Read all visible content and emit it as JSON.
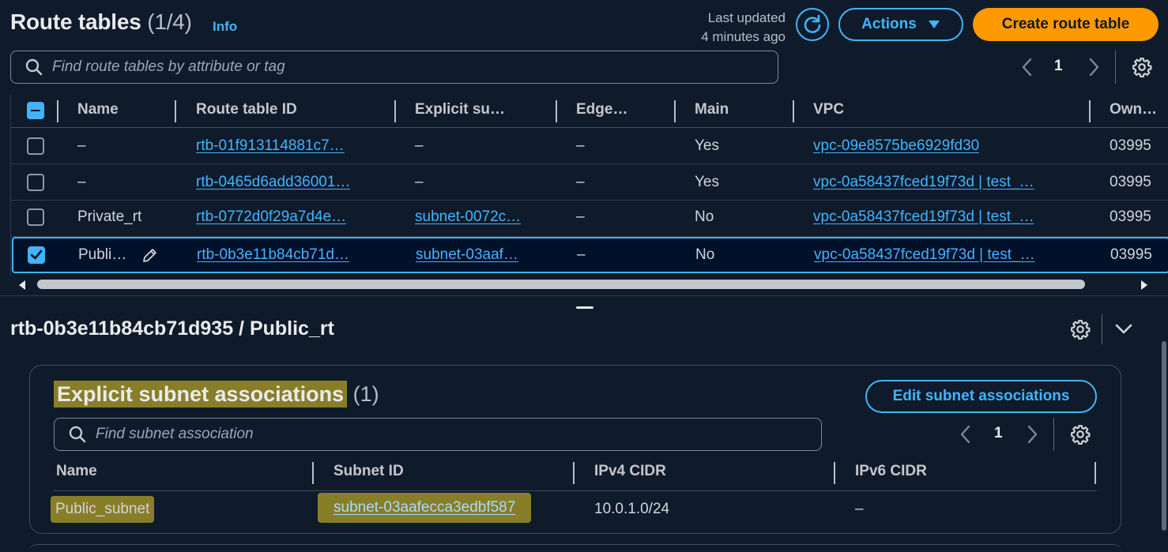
{
  "header": {
    "title": "Route tables",
    "count": "(1/4)",
    "info_label": "Info",
    "last_updated_line1": "Last updated",
    "last_updated_line2": "4 minutes ago",
    "actions_label": "Actions",
    "create_label": "Create route table"
  },
  "search": {
    "placeholder": "Find route tables by attribute or tag"
  },
  "pagination": {
    "page": "1"
  },
  "table": {
    "columns": [
      "Name",
      "Route table ID",
      "Explicit su…",
      "Edge…",
      "Main",
      "VPC",
      "Own…"
    ],
    "rows": [
      {
        "selected": false,
        "name": "–",
        "route_table_id": "rtb-01f913114881c7…",
        "explicit_subnet": "–",
        "edge": "–",
        "main": "Yes",
        "vpc": "vpc-09e8575be6929fd30",
        "owner": "03995"
      },
      {
        "selected": false,
        "name": "–",
        "route_table_id": "rtb-0465d6add36001…",
        "explicit_subnet": "–",
        "edge": "–",
        "main": "Yes",
        "vpc": "vpc-0a58437fced19f73d | test_…",
        "owner": "03995"
      },
      {
        "selected": false,
        "name": "Private_rt",
        "route_table_id": "rtb-0772d0f29a7d4e…",
        "explicit_subnet": "subnet-0072c…",
        "edge": "–",
        "main": "No",
        "vpc": "vpc-0a58437fced19f73d | test_…",
        "owner": "03995"
      },
      {
        "selected": true,
        "name": "Publi…",
        "route_table_id": "rtb-0b3e11b84cb71d…",
        "explicit_subnet": "subnet-03aaf…",
        "edge": "–",
        "main": "No",
        "vpc": "vpc-0a58437fced19f73d | test_…",
        "owner": "03995"
      }
    ]
  },
  "detail": {
    "title": "rtb-0b3e11b84cb71d935 / Public_rt",
    "section_title": "Explicit subnet associations",
    "section_count": "(1)",
    "edit_label": "Edit subnet associations",
    "search_placeholder": "Find subnet association",
    "page": "1",
    "columns": [
      "Name",
      "Subnet ID",
      "IPv4 CIDR",
      "IPv6 CIDR"
    ],
    "rows": [
      {
        "name": "Public_subnet",
        "subnet_id": "subnet-03aafecca3edbf587",
        "ipv4": "10.0.1.0/24",
        "ipv6": "–"
      }
    ]
  },
  "colors": {
    "accent": "#42b4ff",
    "primary_button": "#ff9900",
    "background": "#0f1b2a",
    "highlight": "#b2a028"
  }
}
